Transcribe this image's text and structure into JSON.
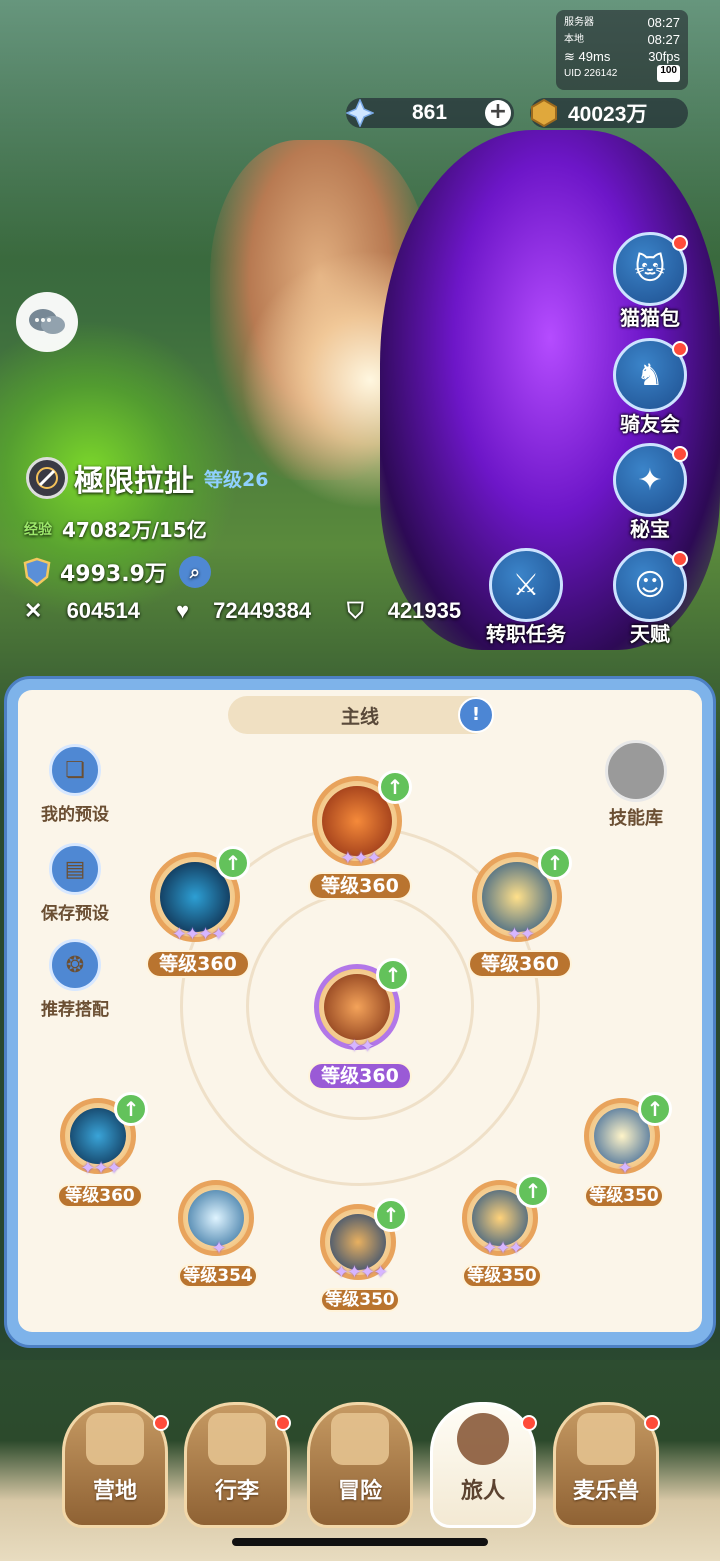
{
  "status": {
    "server_label": "服务器",
    "server_time": "08:27",
    "local_label": "本地",
    "local_time": "08:27",
    "ping": "49ms",
    "fps": "30fps",
    "uid": "UID 226142",
    "battery": "100"
  },
  "currency": {
    "diamonds": "861",
    "gold": "40023万"
  },
  "side_menu": [
    {
      "label": "猫猫包",
      "icon": "cat-bag-icon"
    },
    {
      "label": "骑友会",
      "icon": "horse-icon"
    },
    {
      "label": "秘宝",
      "icon": "treasure-icon"
    },
    {
      "label": "天赋",
      "icon": "brain-icon"
    }
  ],
  "job_task": {
    "label": "转职任务",
    "icon": "cat-knight-icon"
  },
  "player": {
    "name": "極限拉扯",
    "level": "等级26",
    "exp_label": "经验",
    "exp_value": "47082万/15亿",
    "power": "4993.9万",
    "attack": "604514",
    "hp": "72449384",
    "defense": "421935"
  },
  "panel": {
    "tab_title": "主线",
    "left_buttons": [
      "我的预设",
      "保存预设",
      "推荐搭配"
    ],
    "skill_library": "技能库"
  },
  "skills": {
    "top": {
      "level": "等级360"
    },
    "left": {
      "level": "等级360"
    },
    "right": {
      "level": "等级360"
    },
    "center": {
      "level": "等级360"
    },
    "bottom1": {
      "level": "等级360"
    },
    "bottom2": {
      "level": "等级354"
    },
    "bottom3": {
      "level": "等级350"
    },
    "bottom4": {
      "level": "等级350"
    },
    "bottom5": {
      "level": "等级350"
    }
  },
  "nav": [
    "营地",
    "行李",
    "冒险",
    "旅人",
    "麦乐兽"
  ],
  "colors": {
    "accent_blue": "#4f88d3",
    "badge_red": "#ff4b3a",
    "level_brown": "#b9742f",
    "level_purple": "#9a5ad6"
  }
}
